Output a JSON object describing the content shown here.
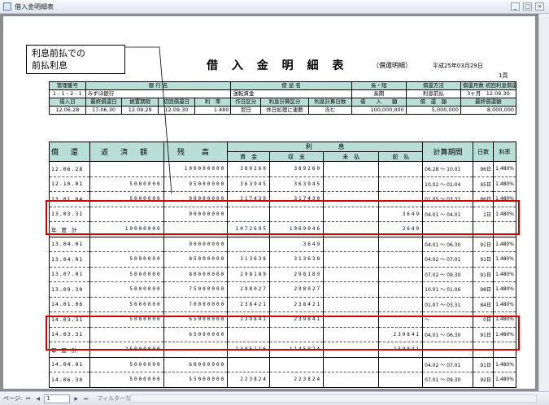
{
  "window": {
    "title": "借入金明細表"
  },
  "report": {
    "title": "借 入 金 明 細 表",
    "subtitle": "（償還明細）",
    "date": "平成25年03月29日",
    "page": "1頁"
  },
  "callout": {
    "line1": "利息前払での",
    "line2": "前払利息"
  },
  "header": {
    "row1_labels": [
      "管理番号",
      "銀 行 名",
      "使 途 名",
      "長・短",
      "償還方法",
      "償還月数",
      "初回利息償還日"
    ],
    "row1_values": [
      "1 - 1 - 2 - 1",
      "みずほ銀行",
      "運転資金",
      "長期",
      "利息前払",
      "3ヶ月",
      "12.09.30"
    ],
    "row2_labels": [
      "借入日",
      "最終償還日",
      "据置期限",
      "初回償還日",
      "利　率",
      "作日区分",
      "利息計算区分",
      "利息計算日数",
      "借　　入　　額",
      "償　還　額",
      "最終償還額"
    ],
    "row2_values": [
      "12.06.28",
      "17.06.30",
      "12.09.29",
      "12.09.30",
      "1.480",
      "翌日",
      "休日処理に連動",
      "含む",
      "100,000,000",
      "5,000,000",
      "8,000,000"
    ]
  },
  "table": {
    "headers": {
      "date": "償 還 日",
      "repay": "返 済 額",
      "balance": "残　高",
      "interest": "利　　　　息",
      "principal": "資　金",
      "income": "収　支",
      "unpaid": "未　払",
      "prepaid": "前　払",
      "period": "計算期間",
      "days": "日数",
      "rate": "利率"
    },
    "rows": [
      {
        "date": "12.06.28",
        "repay": "",
        "balance": "100000000",
        "principal": "389260",
        "income": "389260",
        "unpaid": "",
        "prepaid": "",
        "period": "06.28 ～ 10.01",
        "days": "96日",
        "rate": "1.480%"
      },
      {
        "date": "12.10.01",
        "repay": "5000000",
        "balance": "95000000",
        "principal": "363945",
        "income": "363945",
        "unpaid": "",
        "prepaid": "",
        "period": "10.02 ～ 01.04",
        "days": "95日",
        "rate": "1.480%"
      },
      {
        "date": "13.01.04",
        "repay": "5000000",
        "balance": "90000000",
        "principal": "317430",
        "income": "317430",
        "unpaid": "",
        "prepaid": "",
        "period": "01.05 ～ 03.31",
        "days": "86日",
        "rate": "1.480%"
      },
      {
        "date": "13.03.31",
        "repay": "",
        "balance": "90000000",
        "principal": "",
        "income": "",
        "unpaid": "",
        "prepaid": "3649",
        "period": "04.01 ～ 04.01",
        "days": "1日",
        "rate": "1.480%"
      },
      {
        "date": "年 度 計",
        "repay": "10000000",
        "balance": "",
        "principal": "1072695",
        "income": "1069046",
        "unpaid": "",
        "prepaid": "3649",
        "period": "",
        "days": "",
        "rate": ""
      },
      {
        "date": "13.04.01",
        "repay": "",
        "balance": "90000000",
        "principal": "",
        "income": "3649",
        "unpaid": "",
        "prepaid": "",
        "period": "04.01 ～ 06.30",
        "days": "91日",
        "rate": "1.480%"
      },
      {
        "date": "13.04.01",
        "repay": "5000000",
        "balance": "85000000",
        "principal": "313638",
        "income": "313638",
        "unpaid": "",
        "prepaid": "",
        "period": "04.02 ～ 07.01",
        "days": "91日",
        "rate": "1.480%"
      },
      {
        "date": "13.07.01",
        "repay": "5000000",
        "balance": "80000000",
        "principal": "298189",
        "income": "298189",
        "unpaid": "",
        "prepaid": "",
        "period": "07.02 ～ 09.30",
        "days": "91日",
        "rate": "1.480%"
      },
      {
        "date": "13.09.30",
        "repay": "5000000",
        "balance": "75000000",
        "principal": "298027",
        "income": "298027",
        "unpaid": "",
        "prepaid": "",
        "period": "10.01 ～ 01.06",
        "days": "98日",
        "rate": "1.480%"
      },
      {
        "date": "14.01.06",
        "repay": "5000000",
        "balance": "70000000",
        "principal": "238421",
        "income": "238421",
        "unpaid": "",
        "prepaid": "",
        "period": "01.07 ～ 03.31",
        "days": "84日",
        "rate": "1.480%"
      },
      {
        "date": "14.03.31",
        "repay": "5000000",
        "balance": "65000000",
        "principal": "239841",
        "income": "239841",
        "unpaid": "",
        "prepaid": "",
        "period": "～",
        "days": "0日",
        "rate": "1.480%"
      },
      {
        "date": "14.03.31",
        "repay": "",
        "balance": "65000000",
        "principal": "",
        "income": "",
        "unpaid": "",
        "prepaid": "239841",
        "period": "04.01 ～ 06.30",
        "days": "91日",
        "rate": "1.480%"
      },
      {
        "date": "年 度 計",
        "repay": "25000000",
        "balance": "",
        "principal": "1385116",
        "income": "1145924",
        "unpaid": "",
        "prepaid": "239841",
        "period": "",
        "days": "",
        "rate": ""
      },
      {
        "date": "14.04.01",
        "repay": "5000000",
        "balance": "60000000",
        "principal": "",
        "income": "",
        "unpaid": "",
        "prepaid": "",
        "period": "04.02 ～ 07.01",
        "days": "91日",
        "rate": "1.480%"
      },
      {
        "date": "14.06.30",
        "repay": "5000000",
        "balance": "55000000",
        "principal": "223824",
        "income": "223824",
        "unpaid": "",
        "prepaid": "",
        "period": "07.01 ～ 09.30",
        "days": "92日",
        "rate": "1.480%"
      }
    ]
  },
  "statusbar": {
    "page_label": "ページ:",
    "page_value": "1",
    "filter": "フィルターなし"
  },
  "colors": {
    "header_fill": "#b8ded5",
    "highlight": "#d00000"
  }
}
